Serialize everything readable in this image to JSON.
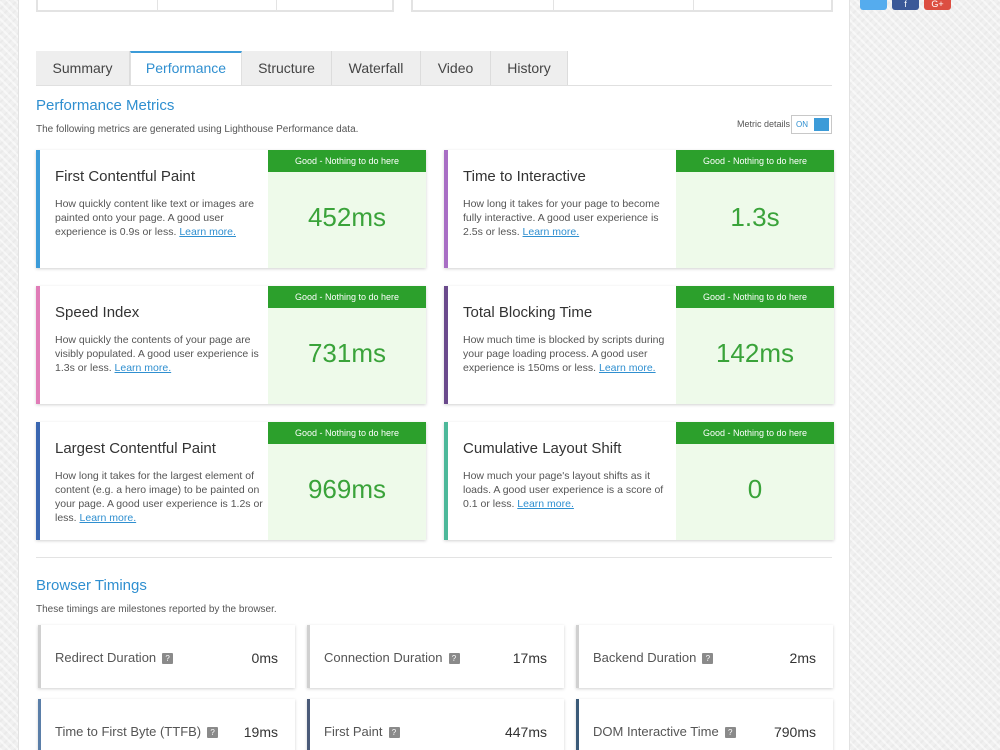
{
  "social": {
    "twitter_glyph": "",
    "facebook_glyph": "f",
    "google_glyph": "G+"
  },
  "tabs": [
    "Summary",
    "Performance",
    "Structure",
    "Waterfall",
    "Video",
    "History"
  ],
  "active_tab": "Performance",
  "performance": {
    "title": "Performance Metrics",
    "description": "The following metrics are generated using Lighthouse Performance data.",
    "toggle_label": "Metric details",
    "toggle_state": "ON"
  },
  "metrics": [
    {
      "title": "First Contentful Paint",
      "desc": "How quickly content like text or images are painted onto your page. A good user experience is 0.9s or less.",
      "link": "Learn more.",
      "badge": "Good - Nothing to do here",
      "value": "452ms",
      "accent": "#3c9bd8"
    },
    {
      "title": "Time to Interactive",
      "desc": "How long it takes for your page to become fully interactive. A good user experience is 2.5s or less.",
      "link": "Learn more.",
      "badge": "Good - Nothing to do here",
      "value": "1.3s",
      "accent": "#a86ec4"
    },
    {
      "title": "Speed Index",
      "desc": "How quickly the contents of your page are visibly populated. A good user experience is 1.3s or less.",
      "link": "Learn more.",
      "badge": "Good - Nothing to do here",
      "value": "731ms",
      "accent": "#e07cb7"
    },
    {
      "title": "Total Blocking Time",
      "desc": "How much time is blocked by scripts during your page loading process. A good user experience is 150ms or less.",
      "link": "Learn more.",
      "badge": "Good - Nothing to do here",
      "value": "142ms",
      "accent": "#6a4a8c"
    },
    {
      "title": "Largest Contentful Paint",
      "desc": "How long it takes for the largest element of content (e.g. a hero image) to be painted on your page. A good user experience is 1.2s or less.",
      "link": "Learn more.",
      "badge": "Good - Nothing to do here",
      "value": "969ms",
      "accent": "#3a66b0"
    },
    {
      "title": "Cumulative Layout Shift",
      "desc": "How much your page's layout shifts as it loads. A good user experience is a score of 0.1 or less.",
      "link": "Learn more.",
      "badge": "Good - Nothing to do here",
      "value": "0",
      "accent": "#4db89a"
    }
  ],
  "browser": {
    "title": "Browser Timings",
    "description": "These timings are milestones reported by the browser."
  },
  "timings": [
    {
      "label": "Redirect Duration",
      "value": "0ms",
      "accent": "#d0d0d0"
    },
    {
      "label": "Connection Duration",
      "value": "17ms",
      "accent": "#d0d0d0"
    },
    {
      "label": "Backend Duration",
      "value": "2ms",
      "accent": "#d0d0d0"
    },
    {
      "label": "Time to First Byte (TTFB)",
      "value": "19ms",
      "accent": "#5a7ea8"
    },
    {
      "label": "First Paint",
      "value": "447ms",
      "accent": "#4a5a78"
    },
    {
      "label": "DOM Interactive Time",
      "value": "790ms",
      "accent": "#3a5a78"
    }
  ],
  "help_glyph": "?",
  "colors": {
    "accent_blue": "#2f8fd0",
    "good_green": "#2ca02c",
    "good_panel": "#eefaea",
    "value_green": "#3aa33a"
  }
}
